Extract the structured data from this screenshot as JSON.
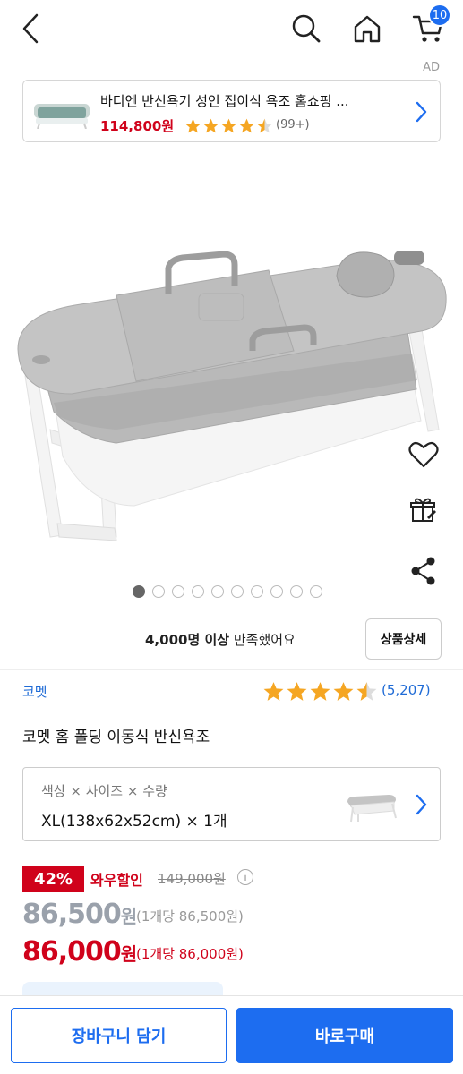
{
  "header": {
    "cart_count": "10"
  },
  "ad": {
    "label": "AD",
    "title": "바디엔 반신욕기 성인 접이식 욕조 홈쇼핑 ...",
    "price": "114,800원",
    "rating": 4.5,
    "review_count": "(99+)"
  },
  "gallery": {
    "total_images": 10,
    "active_index": 0
  },
  "satisfaction": {
    "bold": "4,000명 이상",
    "rest": " 만족했어요"
  },
  "detail_button": "상품상세",
  "product": {
    "brand": "코멧",
    "rating": 4.5,
    "review_count": "(5,207)",
    "name": "코멧 홈 폴딩 이동식 반신욕조"
  },
  "option": {
    "label": "색상 × 사이즈 × 수량",
    "value": "XL(138x62x52cm) × 1개"
  },
  "pricing": {
    "discount": "42%",
    "promo": "와우할인",
    "original": "149,000원",
    "price_normal": "86,500",
    "price_normal_won": "원",
    "price_normal_unit": "(1개당 86,500원)",
    "price_wow": "86,000",
    "price_wow_won": "원",
    "price_wow_unit": "(1개당 86,000원)"
  },
  "bottom": {
    "cart_button": "장바구니 담기",
    "buy_button": "바로구매"
  },
  "colors": {
    "accent_blue": "#1d6df0",
    "sale_red": "#d0021b",
    "star": "#f5a623"
  }
}
